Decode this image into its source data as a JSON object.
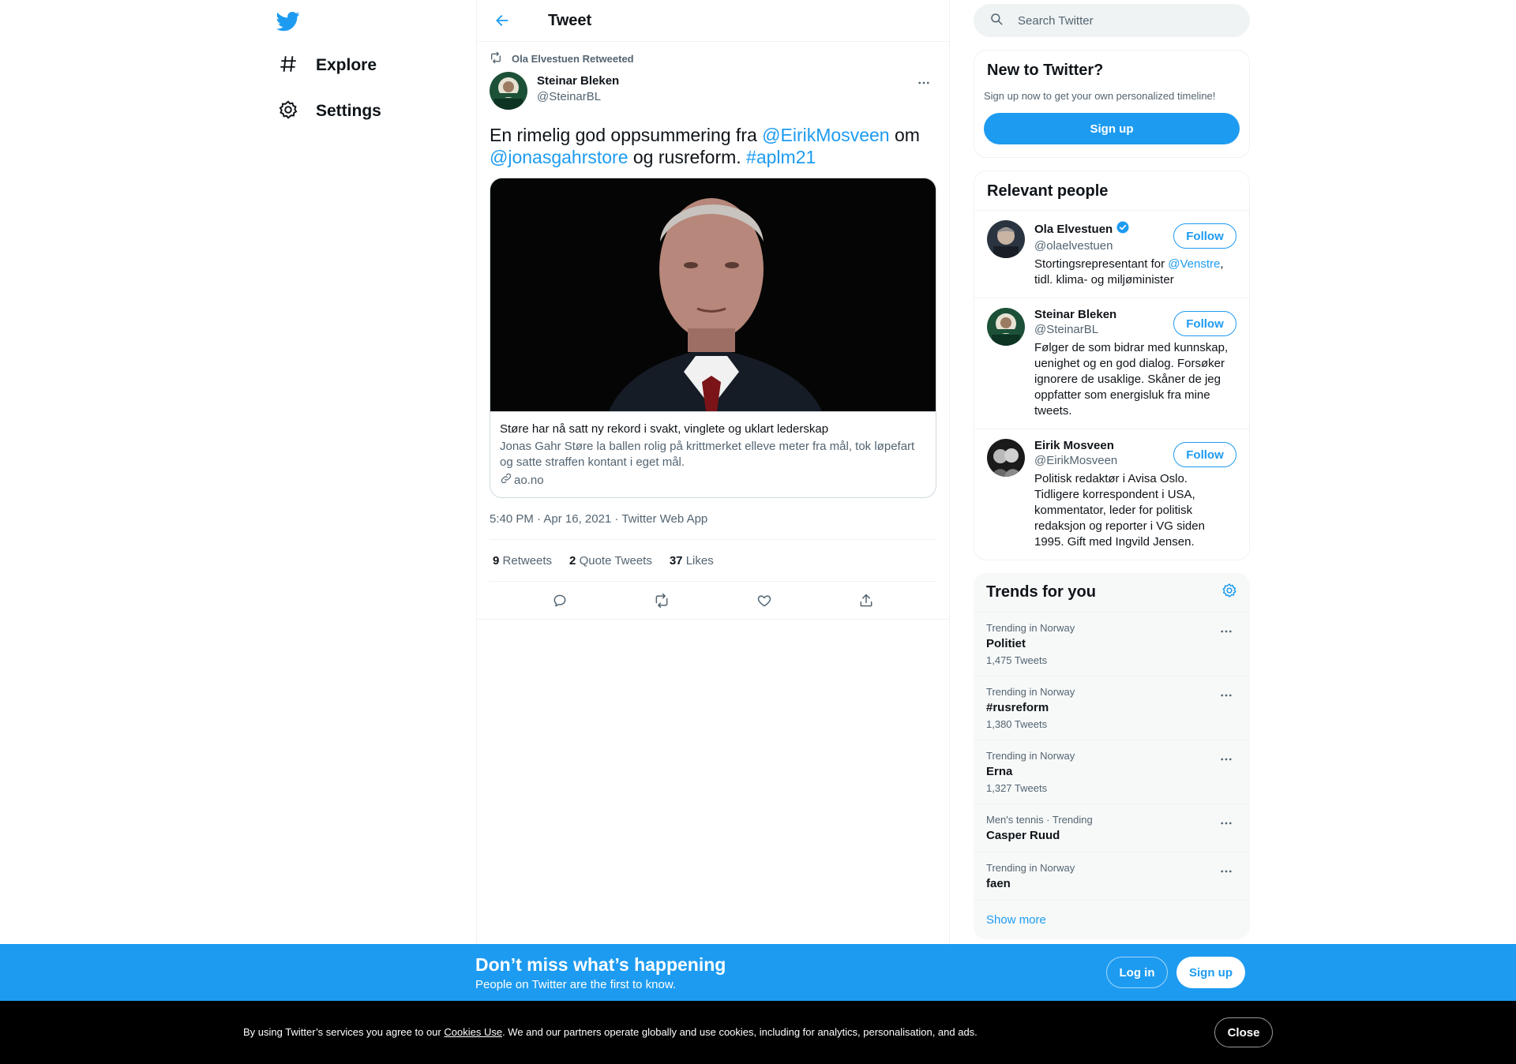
{
  "nav": {
    "logo_icon": "twitter-bird-icon",
    "items": [
      {
        "label": "Explore",
        "icon": "hashtag-icon"
      },
      {
        "label": "Settings",
        "icon": "gear-icon"
      }
    ]
  },
  "header": {
    "title": "Tweet",
    "back_icon": "back-arrow-icon"
  },
  "tweet": {
    "retweeted_by": "Ola Elvestuen Retweeted",
    "author_name": "Steinar Bleken",
    "author_handle": "@SteinarBL",
    "text_parts": [
      {
        "text": "En rimelig god oppsummering fra ",
        "link": false
      },
      {
        "text": "@EirikMosveen",
        "link": true
      },
      {
        "text": " om ",
        "link": false
      },
      {
        "text": "@jonasgahrstore",
        "link": true
      },
      {
        "text": " og rusreform. ",
        "link": false
      },
      {
        "text": "#aplm21",
        "link": true
      }
    ],
    "card": {
      "title": "Støre har nå satt ny rekord i svakt, vinglete og uklart lederskap",
      "description": "Jonas Gahr Støre la ballen rolig på krittmerket elleve meter fra mål, tok løpefart og satte straffen kontant i eget mål.",
      "domain": "ao.no"
    },
    "timestamp": "5:40 PM · Apr 16, 2021 · Twitter Web App",
    "stats": {
      "retweets_count": "9",
      "retweets_label": "Retweets",
      "quotes_count": "2",
      "quotes_label": "Quote Tweets",
      "likes_count": "37",
      "likes_label": "Likes"
    }
  },
  "search": {
    "placeholder": "Search Twitter"
  },
  "new_to_twitter": {
    "title": "New to Twitter?",
    "subtitle": "Sign up now to get your own personalized timeline!",
    "signup_label": "Sign up"
  },
  "relevant_people": {
    "title": "Relevant people",
    "follow_label": "Follow",
    "people": [
      {
        "name": "Ola Elvestuen",
        "handle": "@olaelvestuen",
        "verified": true,
        "bio_before": "Stortingsrepresentant for ",
        "bio_link": "@Venstre",
        "bio_after": ", tidl. klima- og miljøminister"
      },
      {
        "name": "Steinar Bleken",
        "handle": "@SteinarBL",
        "verified": false,
        "bio_before": "Følger de som bidrar med kunnskap, uenighet og en god dialog. Forsøker ignorere de usaklige. Skåner de jeg oppfatter som energisluk fra mine tweets.",
        "bio_link": "",
        "bio_after": ""
      },
      {
        "name": "Eirik Mosveen",
        "handle": "@EirikMosveen",
        "verified": false,
        "bio_before": "Politisk redaktør i Avisa Oslo. Tidligere korrespondent i USA, kommentator, leder for politisk redaksjon og reporter i VG siden 1995. Gift med Ingvild Jensen.",
        "bio_link": "",
        "bio_after": ""
      }
    ]
  },
  "trends": {
    "title": "Trends for you",
    "items": [
      {
        "meta": "Trending in Norway",
        "name": "Politiet",
        "count": "1,475 Tweets"
      },
      {
        "meta": "Trending in Norway",
        "name": "#rusreform",
        "count": "1,380 Tweets"
      },
      {
        "meta": "Trending in Norway",
        "name": "Erna",
        "count": "1,327 Tweets"
      },
      {
        "meta": "Men's tennis · Trending",
        "name": "Casper Ruud",
        "count": ""
      },
      {
        "meta": "Trending in Norway",
        "name": "faen",
        "count": ""
      }
    ],
    "show_more": "Show more"
  },
  "bottom_bar": {
    "title": "Don’t miss what’s happening",
    "subtitle": "People on Twitter are the first to know.",
    "login_label": "Log in",
    "signup_label": "Sign up"
  },
  "cookie_bar": {
    "text_before": "By using Twitter’s services you agree to our ",
    "link": "Cookies Use",
    "text_after": ". We and our partners operate globally and use cookies, including for analytics, personalisation, and ads.",
    "close_label": "Close"
  },
  "colors": {
    "accent": "#1d9bf0",
    "text": "#0f1419",
    "muted": "#536471",
    "border": "#eff3f4"
  }
}
